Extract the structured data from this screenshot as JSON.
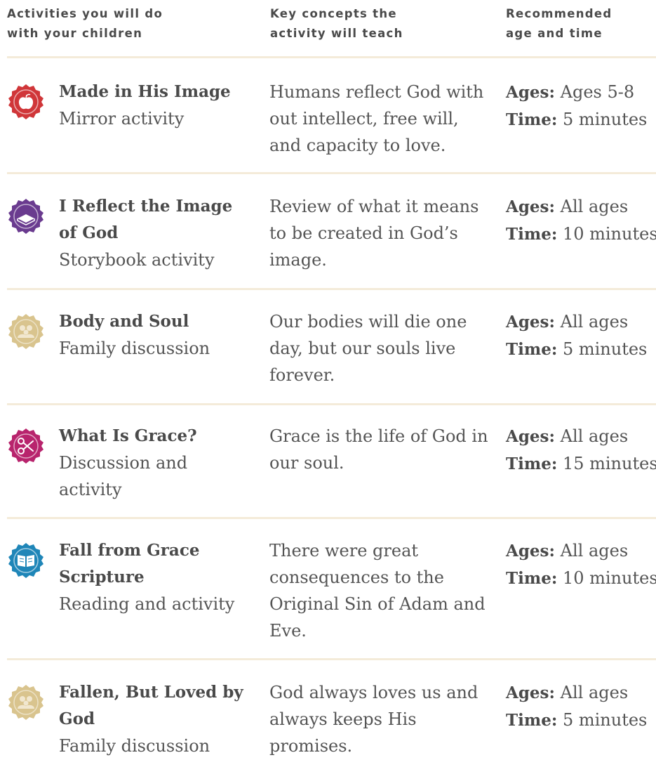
{
  "header": {
    "col1": "Activities you will do\nwith your children",
    "col2": "Key concepts the\nactivity will teach",
    "col3": "Recommended\nage and time"
  },
  "labels": {
    "ages": "Ages:",
    "time": "Time:"
  },
  "rows": [
    {
      "icon": "apple-icon",
      "color": "#d03639",
      "title": "Made in His Image",
      "subtitle": "Mirror activity",
      "concept": "Humans reflect God with out intellect, free will, and capacity to love.",
      "ages": "Ages 5-8",
      "time": "5 minutes"
    },
    {
      "icon": "book-icon",
      "color": "#6a3b8f",
      "title": "I Reflect the Image of God",
      "subtitle": "Storybook activity",
      "concept": "Review of what it means to be created in God’s image.",
      "ages": "All ages",
      "time": "10 minutes"
    },
    {
      "icon": "family-icon",
      "color": "#d9c48e",
      "title": "Body and Soul",
      "subtitle": "Family discussion",
      "concept": "Our bodies will die one day, but our souls live forever.",
      "ages": "All ages",
      "time": "5 minutes"
    },
    {
      "icon": "scissors-icon",
      "color": "#b8246d",
      "title": "What Is Grace?",
      "subtitle": "Discussion and activity",
      "concept": "Grace is the life of God in our soul.",
      "ages": "All ages",
      "time": "15 minutes"
    },
    {
      "icon": "open-book-icon",
      "color": "#1f86b8",
      "title": "Fall from Grace Scripture",
      "subtitle": "Reading and activity",
      "concept": "There were great consequences to the Original Sin of Adam and Eve.",
      "ages": "All ages",
      "time": "10 minutes"
    },
    {
      "icon": "family-icon",
      "color": "#d9c48e",
      "title": "Fallen, But Loved by God",
      "subtitle": "Family discussion",
      "concept": "God always loves us and always keeps His promises.",
      "ages": "All ages",
      "time": "5 minutes"
    }
  ]
}
